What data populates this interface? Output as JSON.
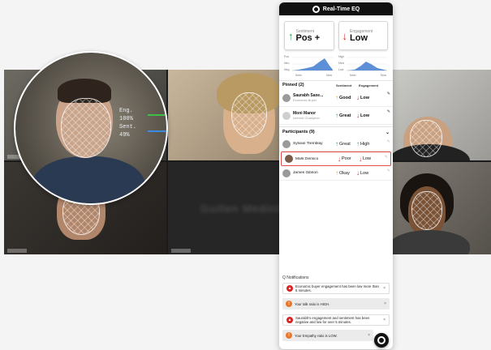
{
  "panel": {
    "title": "Real-Time EQ",
    "sentiment": {
      "label": "Sentiment",
      "value": "Pos +"
    },
    "engagement": {
      "label": "Engagement",
      "value": "Low"
    },
    "sentiment_spark": {
      "levels": [
        "Pos",
        "Neu",
        "Neg"
      ],
      "start": "5min",
      "end": "Now"
    },
    "engagement_spark": {
      "levels": [
        "High",
        "Med",
        "Low"
      ],
      "start": "5min",
      "end": "Now"
    },
    "pinned": {
      "heading": "Pinned (2)",
      "col_sentiment": "Sentiment",
      "col_engagement": "Engagement",
      "rows": [
        {
          "name": "Saurabh Saxe...",
          "role": "Economic Buyer",
          "sentiment": "Good",
          "engagement": "Low"
        },
        {
          "name": "Moni Manor",
          "role": "Internal Champion",
          "sentiment": "Great",
          "engagement": "Low"
        }
      ]
    },
    "participants": {
      "heading": "Participants (9)",
      "rows": [
        {
          "name": "Sylvain Tremblay",
          "sentiment": "Great",
          "engagement": "High"
        },
        {
          "name": "Mark Demico",
          "sentiment": "Poor",
          "engagement": "Low"
        },
        {
          "name": "James Gibson",
          "sentiment": "Okay",
          "engagement": "Low"
        }
      ]
    },
    "notifications": {
      "heading": "Q Notifications",
      "items": [
        {
          "text": "Economic buyer engagement has been low more than 5 minutes.",
          "icon": "warning-icon"
        },
        {
          "text": "Your talk ratio is HIGH.",
          "icon": "alert-icon"
        },
        {
          "text": "Saurabh's engagement and sentiment has been negative and low for over 5 minutes.",
          "icon": "warning-icon"
        },
        {
          "text": "Your Empathy ratio is LOW.",
          "icon": "alert-icon"
        }
      ]
    }
  },
  "overlay": {
    "eng": "Eng. 100%",
    "sent": "Sent. 49%"
  },
  "tile_blur_text": "Guillen Medinilla",
  "colors": {
    "positive": "#2ea043",
    "negative": "#d92323",
    "neutral": "#f0a02a",
    "accent": "#111111"
  }
}
